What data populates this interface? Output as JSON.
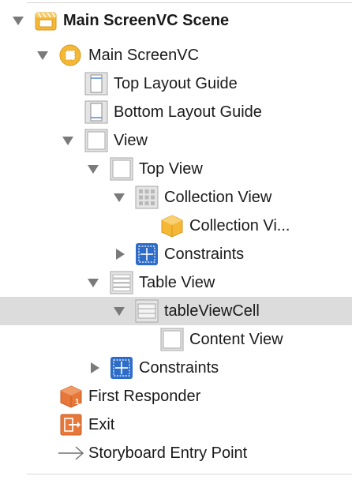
{
  "outline": {
    "items": [
      {
        "label": "Main ScreenVC Scene",
        "icon": "scene-icon",
        "disclosure": "expanded",
        "bold": true
      },
      {
        "label": "Main ScreenVC",
        "icon": "view-controller-icon",
        "disclosure": "expanded"
      },
      {
        "label": "Top Layout Guide",
        "icon": "top-layout-guide-icon",
        "disclosure": "none"
      },
      {
        "label": "Bottom Layout Guide",
        "icon": "bottom-layout-guide-icon",
        "disclosure": "none"
      },
      {
        "label": "View",
        "icon": "view-icon",
        "disclosure": "expanded"
      },
      {
        "label": "Top View",
        "icon": "view-icon",
        "disclosure": "expanded"
      },
      {
        "label": "Collection View",
        "icon": "collection-view-icon",
        "disclosure": "expanded"
      },
      {
        "label": "Collection Vi...",
        "icon": "collection-view-cell-icon",
        "disclosure": "none"
      },
      {
        "label": "Constraints",
        "icon": "constraints-icon",
        "disclosure": "collapsed"
      },
      {
        "label": "Table View",
        "icon": "table-view-icon",
        "disclosure": "expanded"
      },
      {
        "label": "tableViewCell",
        "icon": "table-view-cell-icon",
        "disclosure": "expanded",
        "selected": true
      },
      {
        "label": "Content View",
        "icon": "view-icon",
        "disclosure": "none"
      },
      {
        "label": "Constraints",
        "icon": "constraints-icon",
        "disclosure": "collapsed"
      },
      {
        "label": "First Responder",
        "icon": "first-responder-icon",
        "disclosure": "none"
      },
      {
        "label": "Exit",
        "icon": "exit-icon",
        "disclosure": "none"
      },
      {
        "label": "Storyboard Entry Point",
        "icon": "entry-point-arrow-icon",
        "disclosure": "none"
      }
    ]
  },
  "colors": {
    "selection": "#dcdcdc",
    "scene_icon": "#f5b836",
    "constraints_blue": "#2d6cc8",
    "first_responder_orange": "#e8773a",
    "exit_orange": "#e8773a"
  }
}
